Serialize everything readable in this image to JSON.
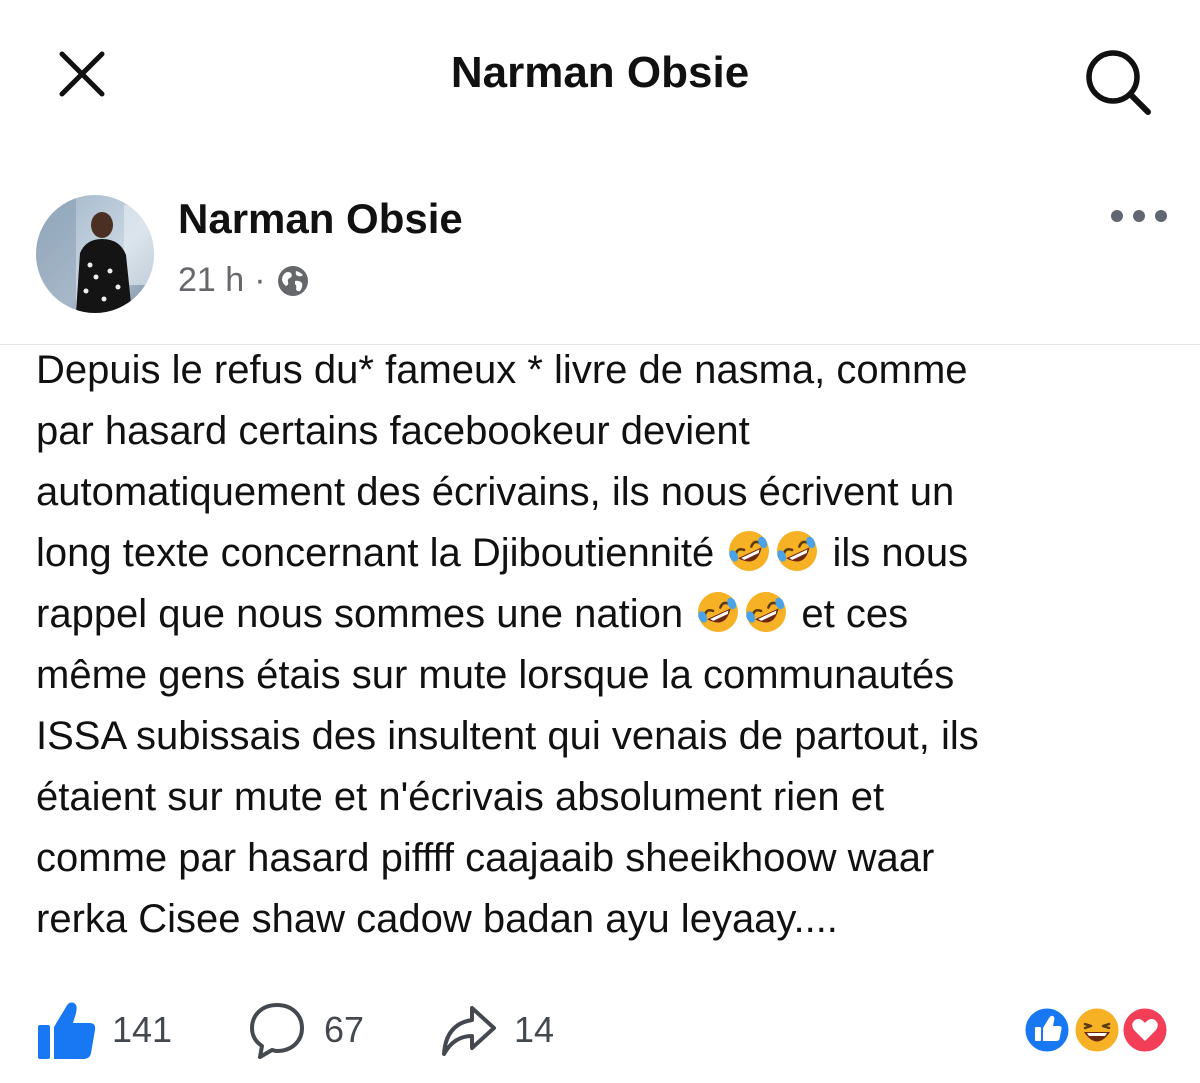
{
  "topbar": {
    "title": "Narman Obsie",
    "close_icon": "close-icon",
    "search_icon": "search-icon"
  },
  "post": {
    "author": "Narman Obsie",
    "time": "21 h",
    "separator": "·",
    "privacy_icon": "globe-icon",
    "more_icon": "more-options-icon",
    "text_lines": [
      "Depuis le refus du* fameux * livre de nasma,  comme",
      "par hasard certains facebookeur devient",
      "automatiquement des écrivains,  ils nous écrivent un",
      "long texte concernant la Djiboutiennité",
      "ils nous",
      "rappel que nous sommes une nation",
      "et ces",
      "même gens étais sur mute lorsque la communautés",
      "ISSA subissais des insultent qui venais de partout,  ils",
      "étaient sur mute et n'écrivais absolument rien et",
      "comme par hasard piffff caajaaib sheeikhoow waar",
      "rerka Cisee shaw cadow badan ayu leyaay...."
    ],
    "emoji_name": "rolling-on-floor-laughing"
  },
  "actions": {
    "likes": "141",
    "comments": "67",
    "shares": "14",
    "reaction_icons": [
      "like-reaction-icon",
      "haha-reaction-icon",
      "love-reaction-icon"
    ]
  },
  "colors": {
    "like_blue": "#1877f2",
    "love_red": "#f33e58",
    "haha_yellow": "#f7b125",
    "meta_gray": "#65676b"
  }
}
